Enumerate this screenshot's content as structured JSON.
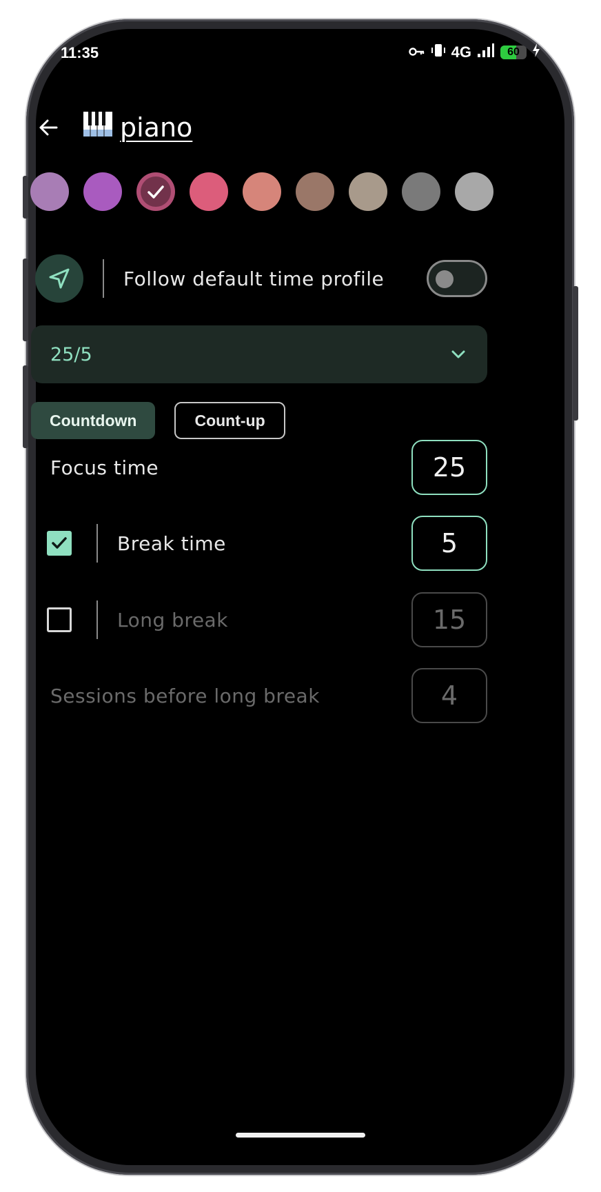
{
  "status_bar": {
    "time": "11:35",
    "network": "4G",
    "battery_level": "60",
    "battery_fraction": 0.6,
    "icons": [
      "vpn-key-icon",
      "vibrate-icon",
      "signal-icon",
      "battery-icon",
      "charging-icon"
    ]
  },
  "header": {
    "back_icon": "arrow-left-icon",
    "title": "piano",
    "title_icon": "piano-keys-icon"
  },
  "colors": {
    "swatches": [
      "#A87DB5",
      "#A95BBF",
      "#B04E74",
      "#DC5D7B",
      "#D6857A",
      "#9A7768",
      "#A89A8B",
      "#7A7A7A",
      "#A8A8A8"
    ],
    "selected_index": 2,
    "accent": "#8FE0C0"
  },
  "follow_profile": {
    "icon": "navigation-arrow-icon",
    "label": "Follow default time profile",
    "enabled": false
  },
  "profile_dropdown": {
    "value": "25/5",
    "icon": "chevron-down-icon"
  },
  "timer_modes": {
    "countdown": "Countdown",
    "countup": "Count-up",
    "active": "Countdown"
  },
  "settings": {
    "focus": {
      "label": "Focus time",
      "value": "25"
    },
    "break": {
      "label": "Break time",
      "value": "5",
      "checked": true
    },
    "long_break": {
      "label": "Long break",
      "value": "15",
      "checked": false
    },
    "sessions": {
      "label": "Sessions before long break",
      "value": "4"
    }
  }
}
